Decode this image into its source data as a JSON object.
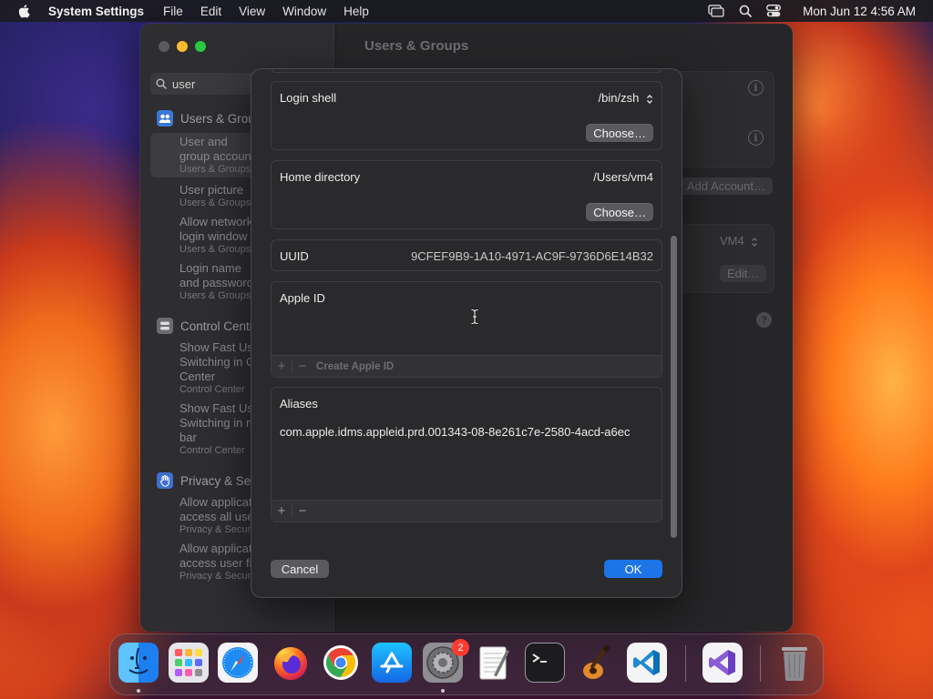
{
  "menubar": {
    "app_name": "System Settings",
    "menus": [
      "File",
      "Edit",
      "View",
      "Window",
      "Help"
    ],
    "clock": "Mon Jun 12  4:56 AM"
  },
  "window": {
    "title": "Users & Groups",
    "search_value": "user",
    "sidebar": {
      "groups": [
        {
          "label": "Users & Groups",
          "items": [
            {
              "title": "User and",
              "title2": "group accounts",
              "sub": "Users & Groups",
              "selected": true
            },
            {
              "title": "User picture",
              "sub": "Users & Groups"
            },
            {
              "title": "Allow network",
              "title2": "login window",
              "sub": "Users & Groups"
            },
            {
              "title": "Login name",
              "title2": "and password",
              "sub": "Users & Groups"
            }
          ]
        },
        {
          "label": "Control Centre",
          "items": [
            {
              "title": "Show Fast User",
              "title2": "Switching in Control",
              "title3": "Center",
              "sub": "Control Center"
            },
            {
              "title": "Show Fast User",
              "title2": "Switching in menu",
              "title3": "bar",
              "sub": "Control Center"
            }
          ]
        },
        {
          "label": "Privacy & Security",
          "items": [
            {
              "title": "Allow applications to",
              "title2": "access all user files",
              "sub": "Privacy & Security"
            },
            {
              "title": "Allow applications to",
              "title2": "access user files",
              "sub": "Privacy & Security"
            }
          ]
        }
      ]
    },
    "background": {
      "add_account": "Add Account…",
      "user_popup": "VM4",
      "edit": "Edit…",
      "help": "?"
    }
  },
  "dialog": {
    "login_shell": {
      "label": "Login shell",
      "value": "/bin/zsh",
      "button": "Choose…"
    },
    "home_directory": {
      "label": "Home directory",
      "value": "/Users/vm4",
      "button": "Choose…"
    },
    "uuid": {
      "label": "UUID",
      "value": "9CFEF9B9-1A10-4971-AC9F-9736D6E14B32"
    },
    "apple_id": {
      "label": "Apple ID",
      "add": "+",
      "remove": "−",
      "create": "Create Apple ID"
    },
    "aliases": {
      "label": "Aliases",
      "items": [
        "com.apple.idms.appleid.prd.001343-08-8e261c7e-2580-4acd-a6ec"
      ],
      "add": "+",
      "remove": "−"
    },
    "cancel": "Cancel",
    "ok": "OK"
  },
  "dock": {
    "apps": [
      "Finder",
      "Launchpad",
      "Safari",
      "Firefox",
      "Google Chrome",
      "App Store",
      "System Settings",
      "TextEdit",
      "Terminal",
      "GarageBand",
      "Visual Studio Code",
      "Visual Studio",
      "Trash"
    ],
    "settings_badge": "2"
  },
  "colors": {
    "accent": "#1d74e6",
    "sheet_bg": "#2a2a2c",
    "badge": "#ff3b30"
  }
}
